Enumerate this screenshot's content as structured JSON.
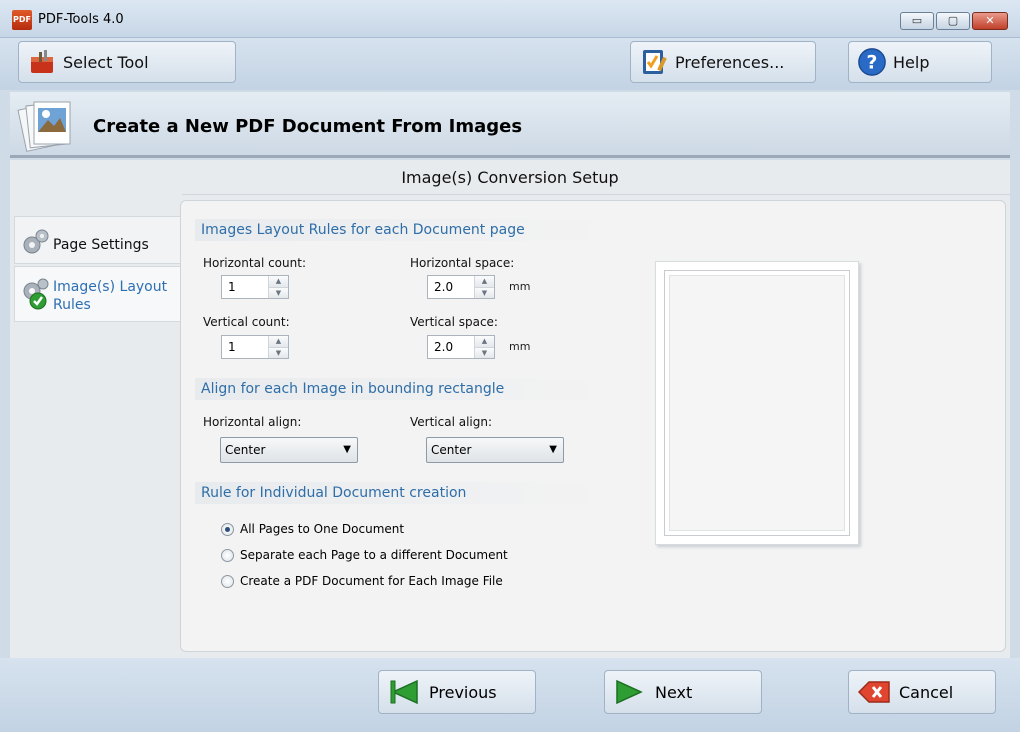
{
  "window": {
    "title": "PDF-Tools 4.0",
    "icon_text": "PDF",
    "controls": {
      "minimize": "▭",
      "maximize": "▢",
      "close": "✕"
    }
  },
  "toolbar": {
    "select_tool": "Select Tool",
    "preferences": "Preferences...",
    "help": "Help"
  },
  "header": {
    "title": "Create a New PDF Document From Images"
  },
  "main": {
    "setup_title": "Image(s) Conversion Setup"
  },
  "tabs": [
    {
      "label": "Page Settings",
      "active": false
    },
    {
      "label": "Image(s) Layout Rules",
      "active": true
    }
  ],
  "layout_rules": {
    "heading": "Images Layout Rules for each Document page",
    "horizontal_count": {
      "label": "Horizontal count:",
      "value": "1"
    },
    "horizontal_space": {
      "label": "Horizontal space:",
      "value": "2.0",
      "unit": "mm"
    },
    "vertical_count": {
      "label": "Vertical count:",
      "value": "1"
    },
    "vertical_space": {
      "label": "Vertical space:",
      "value": "2.0",
      "unit": "mm"
    }
  },
  "align": {
    "heading": "Align for each Image in bounding rectangle",
    "horizontal": {
      "label": "Horizontal align:",
      "value": "Center"
    },
    "vertical": {
      "label": "Vertical align:",
      "value": "Center"
    }
  },
  "rule": {
    "heading": "Rule for Individual Document creation",
    "options": [
      {
        "label": "All Pages to One Document",
        "selected": true
      },
      {
        "label": "Separate each Page to a different Document",
        "selected": false
      },
      {
        "label": "Create a PDF Document for Each Image File",
        "selected": false
      }
    ]
  },
  "footer": {
    "previous": "Previous",
    "next": "Next",
    "cancel": "Cancel"
  },
  "colors": {
    "section_heading": "#2f6ea8",
    "arrow_green": "#2e9d33",
    "cancel_red": "#e0452f"
  }
}
